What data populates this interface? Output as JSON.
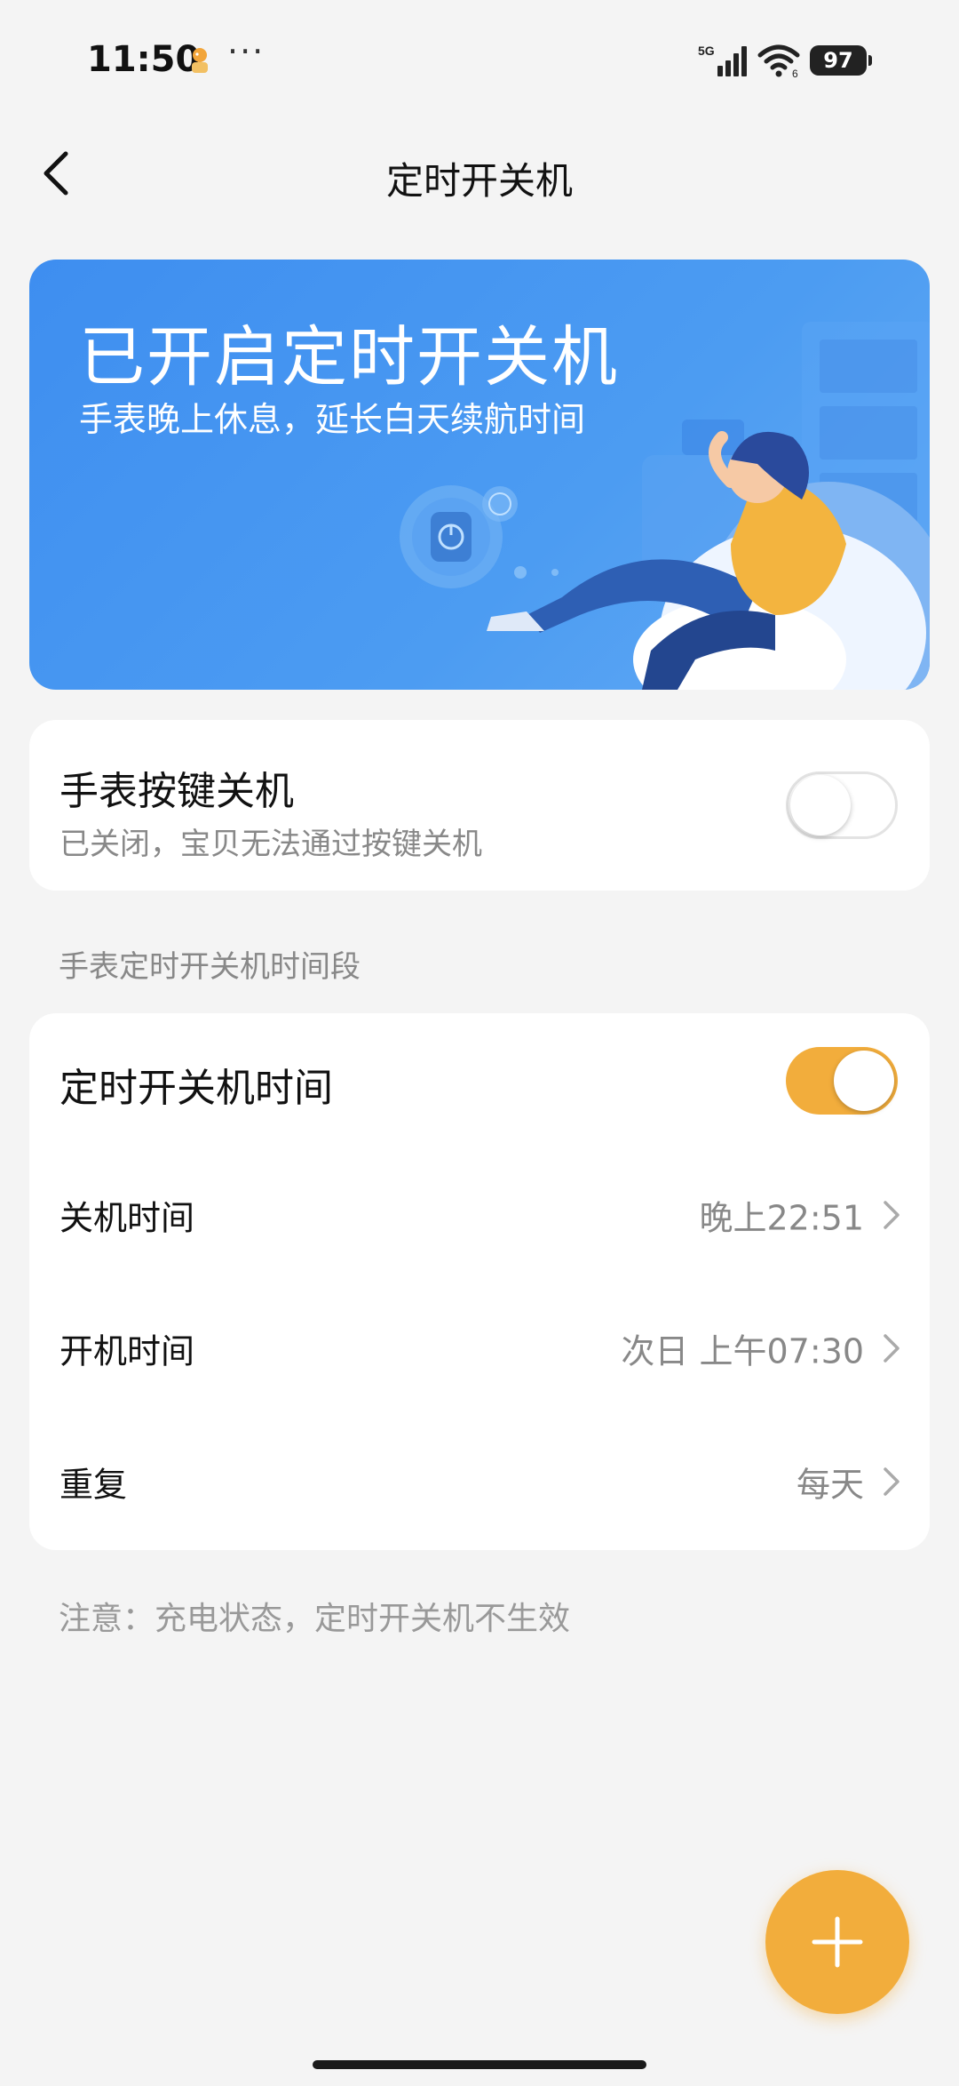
{
  "status_bar": {
    "time": "11:50",
    "dots": "···",
    "network": "5G",
    "battery": "97"
  },
  "nav": {
    "title": "定时开关机"
  },
  "banner": {
    "title": "已开启定时开关机",
    "subtitle": "手表晚上休息，延长白天续航时间"
  },
  "key_power": {
    "title": "手表按键关机",
    "description": "已关闭，宝贝无法通过按键关机",
    "enabled": false
  },
  "section_label": "手表定时开关机时间段",
  "schedule": {
    "title": "定时开关机时间",
    "enabled": true,
    "rows": [
      {
        "label": "关机时间",
        "value": "晚上22:51"
      },
      {
        "label": "开机时间",
        "value": "次日 上午07:30"
      },
      {
        "label": "重复",
        "value": "每天"
      }
    ]
  },
  "notice": "注意：充电状态，定时开关机不生效",
  "colors": {
    "accent": "#f2ad3c",
    "banner_blue": "#4c9cf2",
    "background": "#f4f4f4"
  }
}
